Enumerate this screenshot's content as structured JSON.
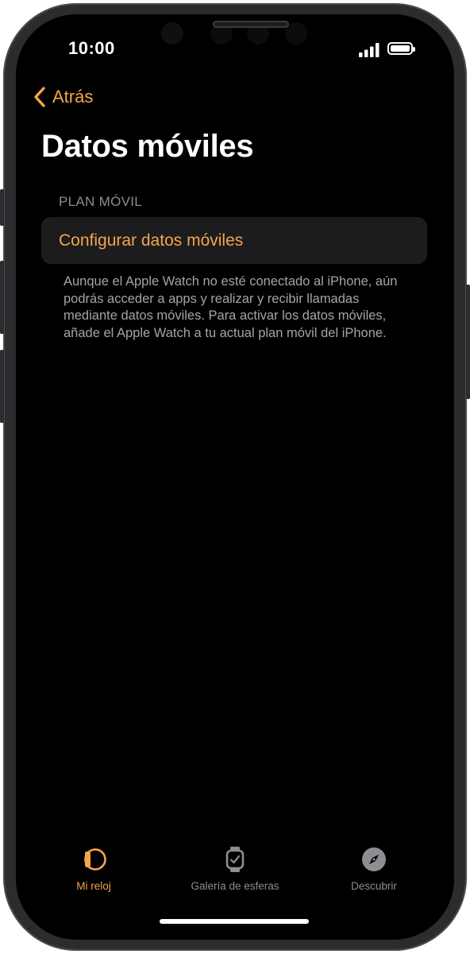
{
  "status_bar": {
    "time": "10:00"
  },
  "nav": {
    "back_label": "Atrás"
  },
  "page": {
    "title": "Datos móviles"
  },
  "section": {
    "header": "PLAN MÓVIL",
    "cell_label": "Configurar datos móviles",
    "footer": "Aunque el Apple Watch no esté conectado al iPhone, aún podrás acceder a apps y realizar y recibir llamadas mediante datos móviles. Para activar los datos móviles, añade el Apple Watch a tu actual plan móvil del iPhone."
  },
  "tabbar": {
    "tabs": [
      {
        "label": "Mi reloj",
        "icon": "watch-face-icon",
        "active": true
      },
      {
        "label": "Galería de esferas",
        "icon": "watch-icon",
        "active": false
      },
      {
        "label": "Descubrir",
        "icon": "compass-icon",
        "active": false
      }
    ]
  },
  "colors": {
    "accent": "#f4a54a",
    "background": "#000000",
    "cell": "#1c1c1e",
    "secondary_text": "#8d8d92",
    "inactive_tab": "#8d8d92"
  }
}
